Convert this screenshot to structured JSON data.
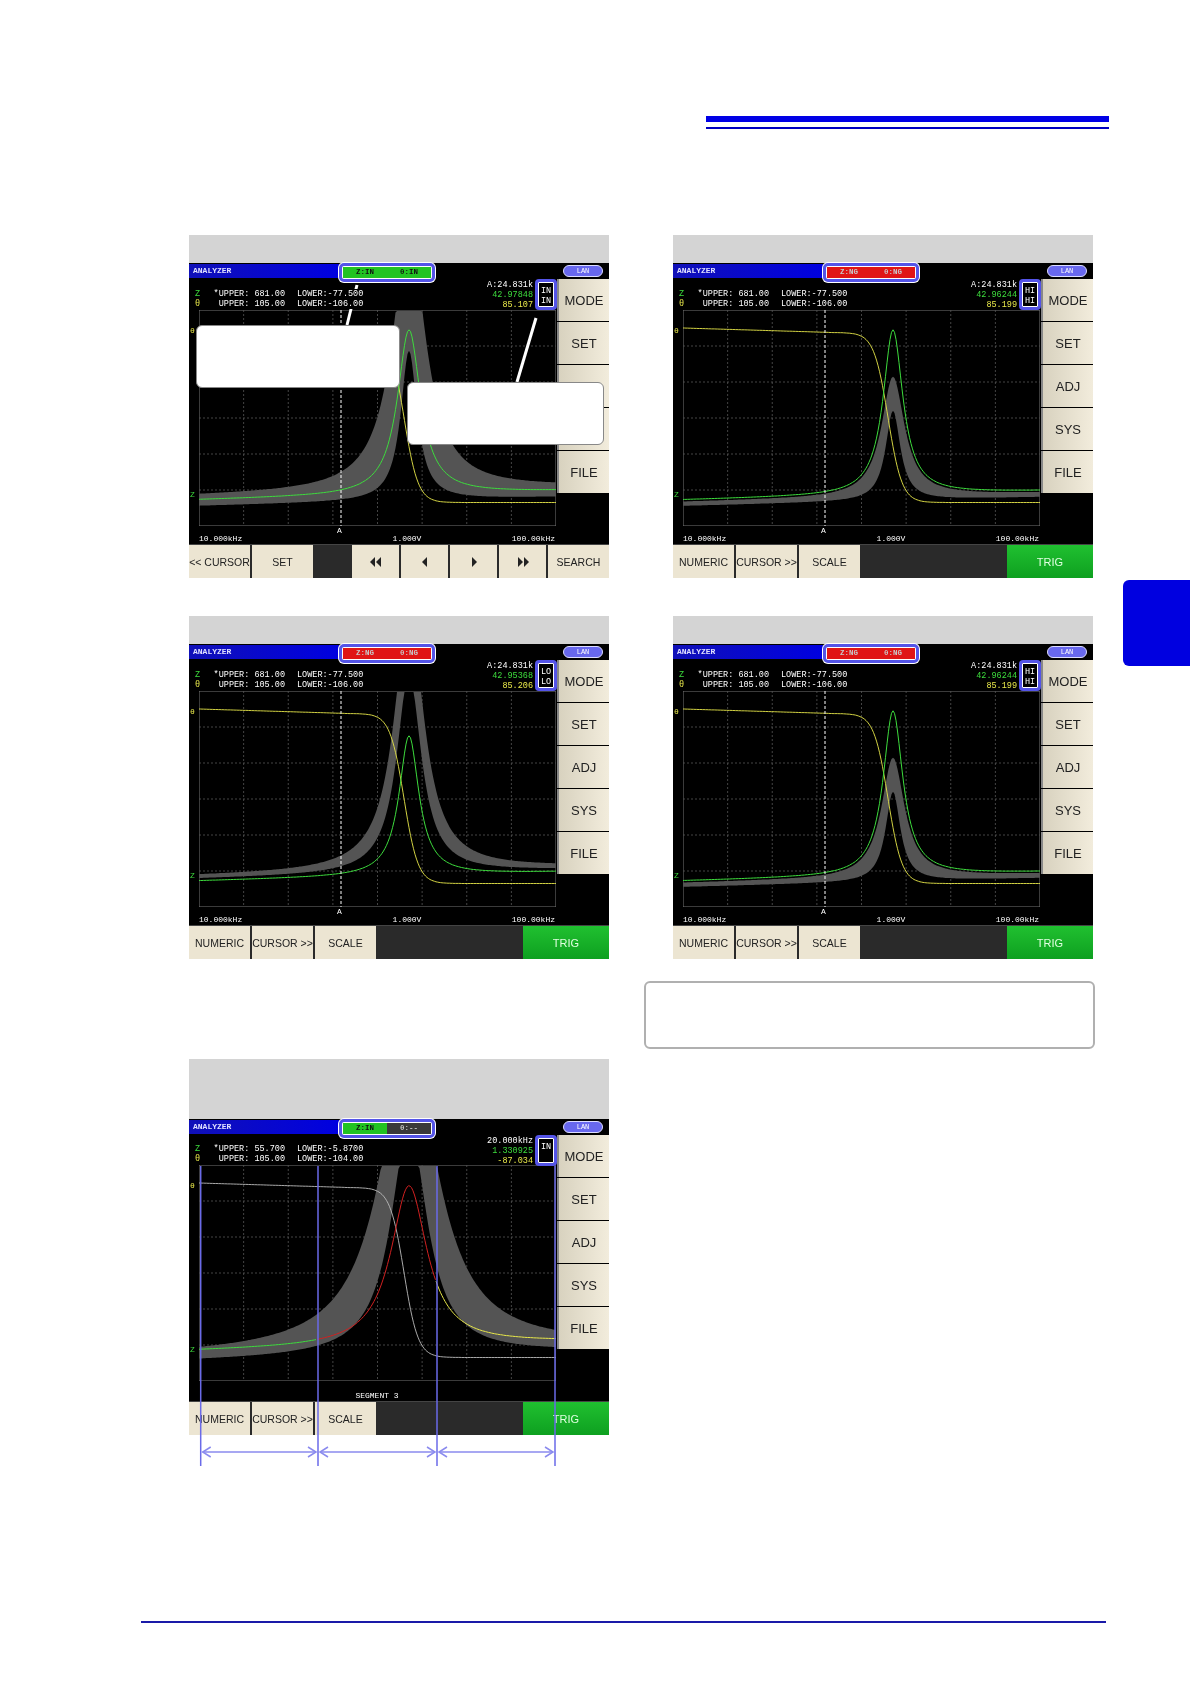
{
  "screens": [
    {
      "kind": "sweep",
      "title": "ANALYZER",
      "badge": [
        {
          "text": "Z:IN",
          "color": "#22c322"
        },
        {
          "text": "θ:IN",
          "color": "#22c322"
        }
      ],
      "lan": "LAN",
      "cursor_readout": "A:24.831k",
      "rows": [
        {
          "label": "Z",
          "upper": "*UPPER: 681.00",
          "lower": "LOWER:-77.500",
          "value": "42.97848",
          "judgment": "IN"
        },
        {
          "label": "θ",
          "upper": "UPPER: 105.00",
          "lower": "LOWER:-106.00",
          "value": "85.107",
          "judgment": "IN"
        }
      ],
      "graph": {
        "kind": "inside",
        "top_label": "θ",
        "bottom_label": "Z"
      },
      "axis": {
        "start": "10.000kHz",
        "cursor": "A",
        "signal": "1.000V",
        "stop": "100.00kHz"
      },
      "side_buttons": [
        {
          "kind": "key",
          "label": "MODE"
        },
        {
          "kind": "key",
          "label": "SET"
        },
        {
          "kind": "blank"
        },
        {
          "kind": "blank"
        },
        {
          "kind": "key",
          "label": "FILE"
        }
      ],
      "bottom_left": [
        {
          "kind": "key",
          "label": "<< CURSOR"
        },
        {
          "kind": "key",
          "label": "SET"
        }
      ],
      "bottom_right": [
        {
          "kind": "rewind"
        },
        {
          "kind": "back"
        },
        {
          "kind": "forward"
        },
        {
          "kind": "fastforward"
        },
        {
          "kind": "key",
          "label": "SEARCH"
        }
      ],
      "callouts": true
    },
    {
      "kind": "sweep",
      "title": "ANALYZER",
      "badge": [
        {
          "text": "Z:NG",
          "color": "#e01515"
        },
        {
          "text": "θ:NG",
          "color": "#e01515"
        }
      ],
      "lan": "LAN",
      "cursor_readout": "A:24.831k",
      "rows": [
        {
          "label": "Z",
          "upper": "*UPPER: 681.00",
          "lower": "LOWER:-77.500",
          "value": "42.96244",
          "judgment": "HI"
        },
        {
          "label": "θ",
          "upper": "UPPER: 105.00",
          "lower": "LOWER:-106.00",
          "value": "85.199",
          "judgment": "HI"
        }
      ],
      "graph": {
        "kind": "above",
        "top_label": "θ",
        "bottom_label": "Z"
      },
      "axis": {
        "start": "10.000kHz",
        "cursor": "A",
        "signal": "1.000V",
        "stop": "100.00kHz"
      },
      "side_buttons": [
        {
          "kind": "key",
          "label": "MODE"
        },
        {
          "kind": "key",
          "label": "SET"
        },
        {
          "kind": "key",
          "label": "ADJ"
        },
        {
          "kind": "key",
          "label": "SYS"
        },
        {
          "kind": "key",
          "label": "FILE"
        }
      ],
      "bottom_left": [
        {
          "kind": "key",
          "label": "NUMERIC"
        },
        {
          "kind": "key",
          "label": "CURSOR >>"
        },
        {
          "kind": "key",
          "label": "SCALE"
        }
      ],
      "bottom_right": [
        {
          "kind": "trig",
          "label": "TRIG"
        }
      ]
    },
    {
      "kind": "sweep",
      "title": "ANALYZER",
      "badge": [
        {
          "text": "Z:NG",
          "color": "#e01515"
        },
        {
          "text": "θ:NG",
          "color": "#e01515"
        }
      ],
      "lan": "LAN",
      "cursor_readout": "A:24.831k",
      "rows": [
        {
          "label": "Z",
          "upper": "*UPPER: 681.00",
          "lower": "LOWER:-77.500",
          "value": "42.95368",
          "judgment": "LO"
        },
        {
          "label": "θ",
          "upper": "UPPER: 105.00",
          "lower": "LOWER:-106.00",
          "value": "85.206",
          "judgment": "LO"
        }
      ],
      "graph": {
        "kind": "below",
        "top_label": "θ",
        "bottom_label": "Z"
      },
      "axis": {
        "start": "10.000kHz",
        "cursor": "A",
        "signal": "1.000V",
        "stop": "100.00kHz"
      },
      "side_buttons": [
        {
          "kind": "key",
          "label": "MODE"
        },
        {
          "kind": "key",
          "label": "SET"
        },
        {
          "kind": "key",
          "label": "ADJ"
        },
        {
          "kind": "key",
          "label": "SYS"
        },
        {
          "kind": "key",
          "label": "FILE"
        }
      ],
      "bottom_left": [
        {
          "kind": "key",
          "label": "NUMERIC"
        },
        {
          "kind": "key",
          "label": "CURSOR >>"
        },
        {
          "kind": "key",
          "label": "SCALE"
        }
      ],
      "bottom_right": [
        {
          "kind": "trig",
          "label": "TRIG"
        }
      ]
    },
    {
      "kind": "sweep",
      "title": "ANALYZER",
      "badge": [
        {
          "text": "Z:NG",
          "color": "#e01515"
        },
        {
          "text": "θ:NG",
          "color": "#e01515"
        }
      ],
      "lan": "LAN",
      "cursor_readout": "A:24.831k",
      "rows": [
        {
          "label": "Z",
          "upper": "*UPPER: 681.00",
          "lower": "LOWER:-77.500",
          "value": "42.96244",
          "judgment": "HI"
        },
        {
          "label": "θ",
          "upper": "UPPER: 105.00",
          "lower": "LOWER:-106.00",
          "value": "85.199",
          "judgment": "HI"
        }
      ],
      "graph": {
        "kind": "above",
        "top_label": "θ",
        "bottom_label": "Z"
      },
      "axis": {
        "start": "10.000kHz",
        "cursor": "A",
        "signal": "1.000V",
        "stop": "100.00kHz"
      },
      "side_buttons": [
        {
          "kind": "key",
          "label": "MODE"
        },
        {
          "kind": "key",
          "label": "SET"
        },
        {
          "kind": "key",
          "label": "ADJ"
        },
        {
          "kind": "key",
          "label": "SYS"
        },
        {
          "kind": "key",
          "label": "FILE"
        }
      ],
      "bottom_left": [
        {
          "kind": "key",
          "label": "NUMERIC"
        },
        {
          "kind": "key",
          "label": "CURSOR >>"
        },
        {
          "kind": "key",
          "label": "SCALE"
        }
      ],
      "bottom_right": [
        {
          "kind": "trig",
          "label": "TRIG"
        }
      ]
    },
    {
      "kind": "segment",
      "title": "ANALYZER",
      "badge": [
        {
          "text": "Z:IN",
          "color": "#22c322"
        },
        {
          "text": "θ:--",
          "color": "#3a3a3a"
        }
      ],
      "lan": "LAN",
      "cursor_readout": "20.000kHz",
      "rows": [
        {
          "label": "Z",
          "upper": "*UPPER: 55.700",
          "lower": "LOWER:-5.8700",
          "value": "1.330925",
          "judgment": "IN"
        },
        {
          "label": "θ",
          "upper": "UPPER: 105.00",
          "lower": "LOWER:-104.00",
          "value": "-87.034"
        }
      ],
      "graph": {
        "kind": "segmented",
        "top_label": "θ",
        "bottom_label": "Z"
      },
      "segment_label": "SEGMENT 3",
      "side_buttons": [
        {
          "kind": "key",
          "label": "MODE"
        },
        {
          "kind": "key",
          "label": "SET"
        },
        {
          "kind": "key",
          "label": "ADJ"
        },
        {
          "kind": "key",
          "label": "SYS"
        },
        {
          "kind": "key",
          "label": "FILE"
        }
      ],
      "bottom_left": [
        {
          "kind": "key",
          "label": "NUMERIC"
        },
        {
          "kind": "key",
          "label": "CURSOR >>"
        },
        {
          "kind": "key",
          "label": "SCALE"
        }
      ],
      "bottom_right": [
        {
          "kind": "trig",
          "label": "TRIG"
        }
      ]
    }
  ],
  "note_box": {
    "kind": "empty"
  }
}
